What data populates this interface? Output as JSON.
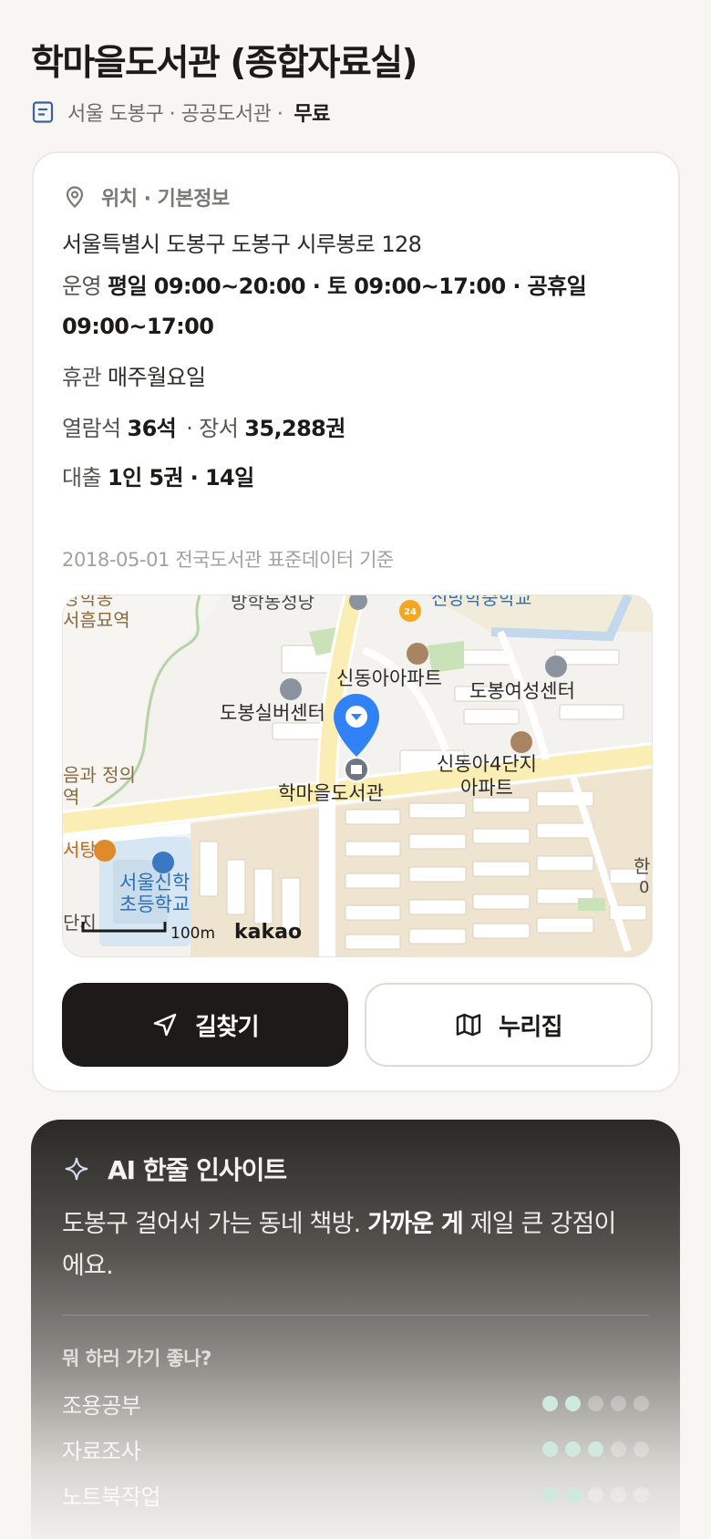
{
  "header": {
    "title": "학마을도서관 (종합자료실)",
    "meta": "서울 도봉구 · 공공도서관 ·",
    "fee": "무료"
  },
  "info": {
    "section_title": "위치 · 기본정보",
    "address": "서울특별시 도봉구 도봉구 시루봉로 128",
    "hours_label": "운영",
    "hours_value": "평일 09:00~20:00 · 토 09:00~17:00 · 공휴일 09:00~17:00",
    "closed_label": "휴관",
    "closed_value": "매주월요일",
    "seats_label": "열람석",
    "seats_value": "36석",
    "books_label": "장서",
    "books_value": "35,288권",
    "loan_label": "대출",
    "loan_value": "1인 5권 · 14일",
    "source_note": "2018-05-01 전국도서관 표준데이터 기준"
  },
  "map": {
    "labels": {
      "apt1": "신동아아파트",
      "women_center": "도봉여성센터",
      "senior_center": "도봉실버센터",
      "library": "학마을도서관",
      "apt2_line1": "신동아4단지",
      "apt2_line2": "아파트",
      "school_top": "방학동성당",
      "school_top_right": "신방학중학교",
      "elem_line1": "서울신학",
      "elem_line2": "초등학교",
      "left_top1": "방학동",
      "left_top2": "서흠묘역",
      "left_mid1": "음과 정의",
      "left_mid2": "역",
      "left_food": "서탕",
      "left_bottom": "단지",
      "right_edge1": "한",
      "right_edge2": "0"
    },
    "scale_label": "100m",
    "brand": "kakao"
  },
  "actions": {
    "directions_label": "길찾기",
    "website_label": "누리집"
  },
  "ai": {
    "title": "AI 한줄 인사이트",
    "text_a": "도봉구 걸어서 가는 동네 책방. ",
    "text_bold": "가까운 게",
    "text_b": " 제일 큰 강점이에요.",
    "question": "뭐 하러 가기 좋나?",
    "ratings": [
      {
        "name": "조용공부",
        "score": 2,
        "max": 5
      },
      {
        "name": "자료조사",
        "score": 3,
        "max": 5
      },
      {
        "name": "노트북작업",
        "score": 2,
        "max": 5
      }
    ]
  },
  "colors": {
    "accent_dark": "#1c1b19",
    "pin_blue": "#3182f6",
    "rating_on": "#cfe9df"
  }
}
